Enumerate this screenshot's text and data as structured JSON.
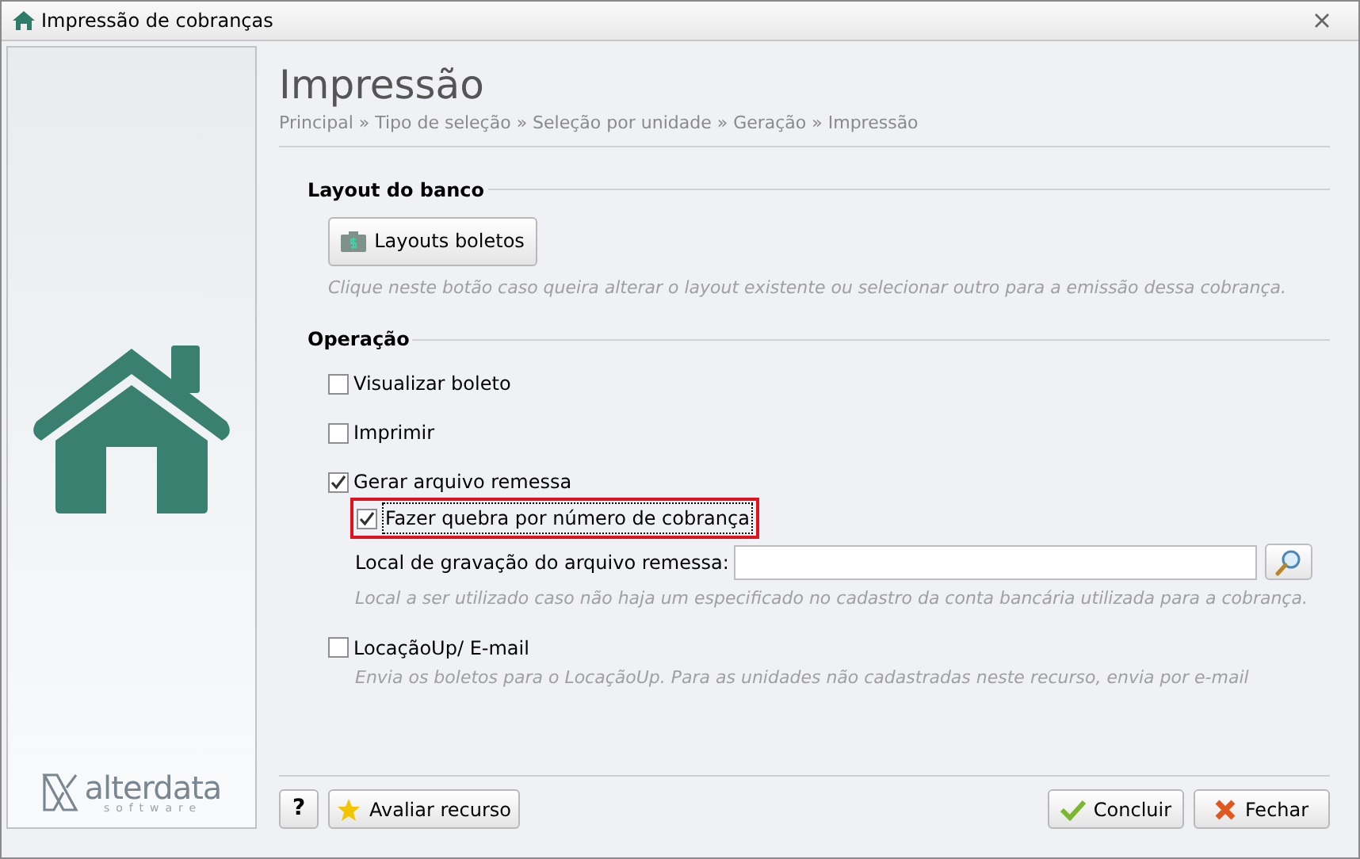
{
  "window": {
    "title": "Impressão de cobranças"
  },
  "sidebar": {
    "logo_text": "alterdata",
    "logo_subtext": "software"
  },
  "header": {
    "title": "Impressão",
    "breadcrumb": "Principal » Tipo de seleção » Seleção por unidade » Geração » Impressão"
  },
  "layout_section": {
    "title": "Layout do banco",
    "button": "Layouts boletos",
    "hint": "Clique neste botão caso queira alterar o layout existente ou selecionar outro para a emissão dessa cobrança."
  },
  "operation_section": {
    "title": "Operação",
    "items": [
      {
        "kind": "checkbox",
        "label": "Visualizar boleto",
        "checked": false
      },
      {
        "kind": "checkbox",
        "label": "Imprimir",
        "checked": false
      },
      {
        "kind": "checkbox",
        "label": "Gerar arquivo remessa",
        "checked": true,
        "children": [
          {
            "kind": "checkbox",
            "label": "Fazer quebra por número de cobrança",
            "checked": true,
            "highlighted": true
          },
          {
            "kind": "path_field",
            "label": "Local de gravação do arquivo remessa:",
            "hint": "Local a ser utilizado caso não haja um especificado no cadastro da conta bancária utilizada para a cobrança."
          }
        ]
      },
      {
        "kind": "checkbox",
        "label": "LocaçãoUp/ E-mail",
        "checked": false,
        "hint": "Envia os boletos para o LocaçãoUp. Para as unidades não cadastradas neste recurso, envia por e-mail"
      }
    ]
  },
  "footer": {
    "help_button": "?",
    "rate_button": "Avaliar recurso",
    "finish_button": "Concluir",
    "close_button": "Fechar"
  }
}
